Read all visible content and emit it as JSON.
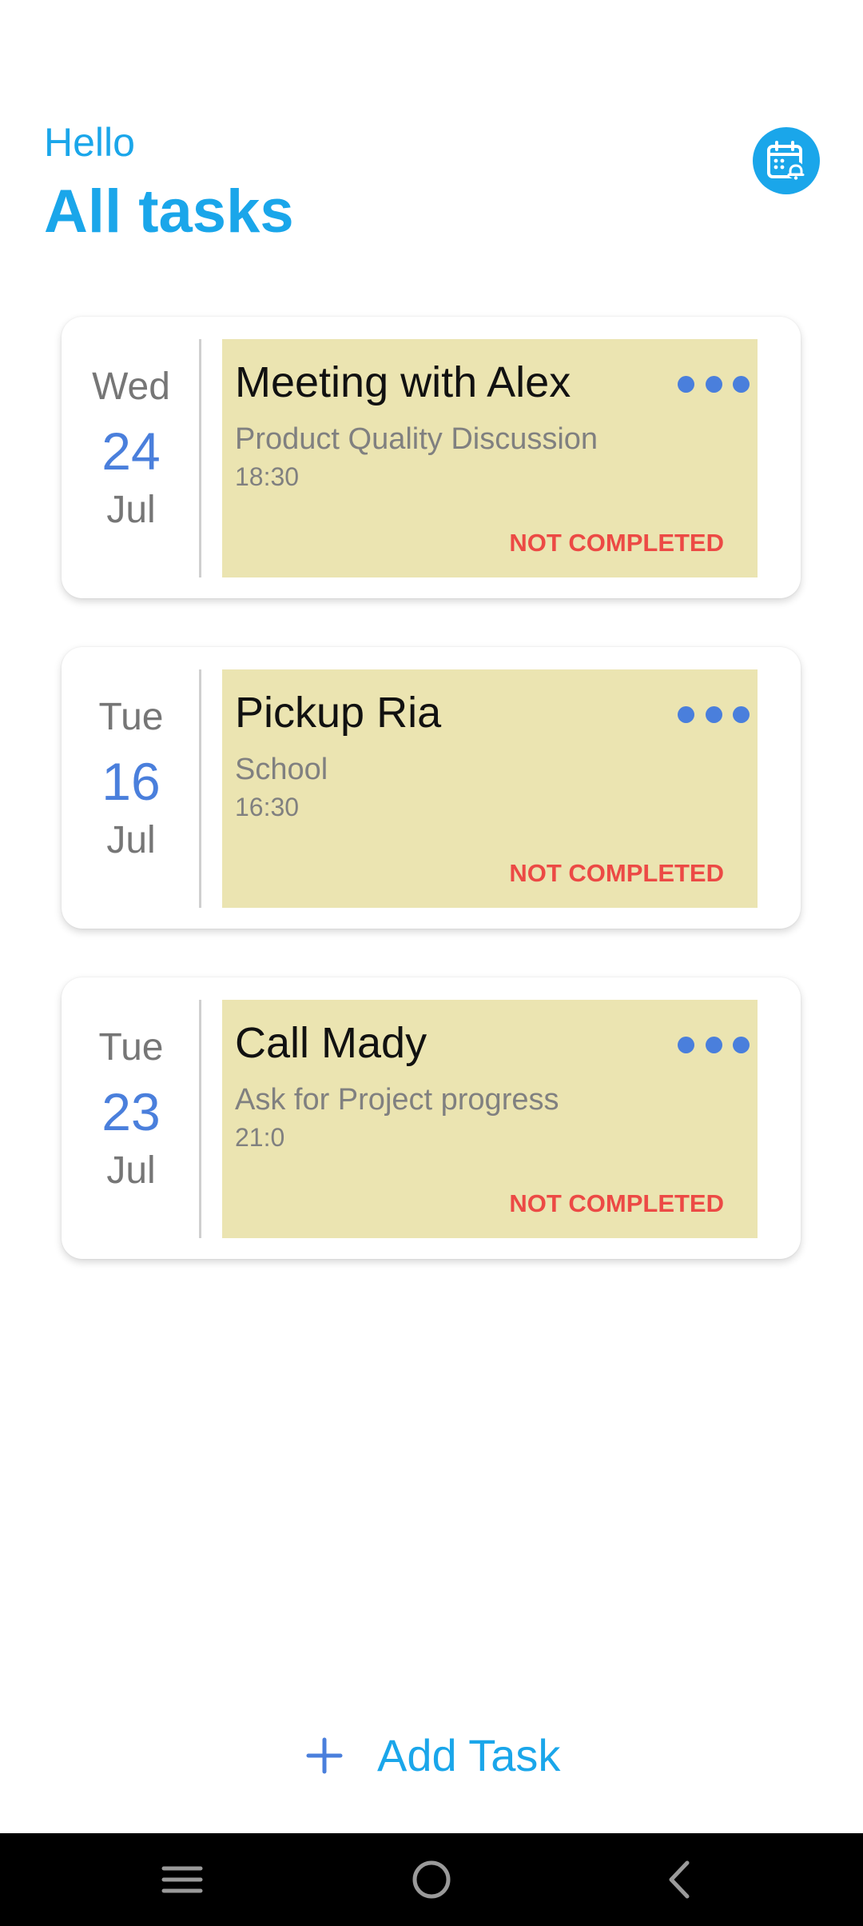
{
  "header": {
    "greeting": "Hello",
    "title": "All tasks",
    "calendar_icon": "calendar-bell-icon"
  },
  "tasks": [
    {
      "weekday": "Wed",
      "day": "24",
      "month": "Jul",
      "title": "Meeting with Alex",
      "description": "Product Quality Discussion",
      "time": "18:30",
      "status": "NOT COMPLETED"
    },
    {
      "weekday": "Tue",
      "day": "16",
      "month": "Jul",
      "title": "Pickup Ria",
      "description": "School",
      "time": "16:30",
      "status": "NOT COMPLETED"
    },
    {
      "weekday": "Tue",
      "day": "23",
      "month": "Jul",
      "title": "Call Mady",
      "description": "Ask for Project progress",
      "time": "21:0",
      "status": "NOT COMPLETED"
    }
  ],
  "add_task": {
    "label": "Add Task",
    "icon": "plus-icon"
  },
  "nav_bar": {
    "icons": [
      "menu-icon",
      "home-icon",
      "back-icon"
    ]
  },
  "colors": {
    "accent": "#1aa6ea",
    "date_number": "#4a7fdc",
    "card_body": "#ebe4b1",
    "status_not_completed": "#ec4a45"
  }
}
